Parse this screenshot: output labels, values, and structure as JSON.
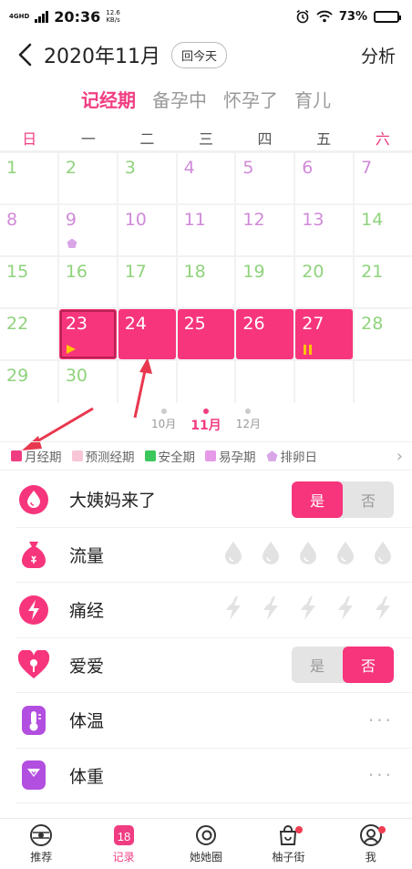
{
  "status_bar": {
    "network": "4GHD",
    "time": "20:36",
    "speed_value": "12.6",
    "speed_unit": "KB/s",
    "battery": "73%",
    "battery_level": 0.73
  },
  "header": {
    "title": "2020年11月",
    "today_button": "回今天",
    "analysis": "分析"
  },
  "mode_tabs": [
    {
      "label": "记经期",
      "active": true
    },
    {
      "label": "备孕中",
      "active": false
    },
    {
      "label": "怀孕了",
      "active": false
    },
    {
      "label": "育儿",
      "active": false
    }
  ],
  "weekdays": [
    "日",
    "一",
    "二",
    "三",
    "四",
    "五",
    "六"
  ],
  "days": [
    {
      "n": "1",
      "type": "green"
    },
    {
      "n": "2",
      "type": "green"
    },
    {
      "n": "3",
      "type": "green"
    },
    {
      "n": "4",
      "type": "purple"
    },
    {
      "n": "5",
      "type": "purple"
    },
    {
      "n": "6",
      "type": "purple"
    },
    {
      "n": "7",
      "type": "purple"
    },
    {
      "n": "8",
      "type": "purple"
    },
    {
      "n": "9",
      "type": "purple",
      "mark": "ovulation"
    },
    {
      "n": "10",
      "type": "purple"
    },
    {
      "n": "11",
      "type": "purple"
    },
    {
      "n": "12",
      "type": "purple"
    },
    {
      "n": "13",
      "type": "purple"
    },
    {
      "n": "14",
      "type": "green"
    },
    {
      "n": "15",
      "type": "green"
    },
    {
      "n": "16",
      "type": "green"
    },
    {
      "n": "17",
      "type": "green"
    },
    {
      "n": "18",
      "type": "green"
    },
    {
      "n": "19",
      "type": "green"
    },
    {
      "n": "20",
      "type": "green"
    },
    {
      "n": "21",
      "type": "green"
    },
    {
      "n": "22",
      "type": "green"
    },
    {
      "n": "23",
      "type": "period",
      "selected": true,
      "mark": "start"
    },
    {
      "n": "24",
      "type": "period"
    },
    {
      "n": "25",
      "type": "period"
    },
    {
      "n": "26",
      "type": "period"
    },
    {
      "n": "27",
      "type": "period",
      "mark": "end"
    },
    {
      "n": "28",
      "type": "green"
    },
    {
      "n": "29",
      "type": "green"
    },
    {
      "n": "30",
      "type": "green"
    },
    {
      "n": "",
      "type": "empty"
    },
    {
      "n": "",
      "type": "empty"
    },
    {
      "n": "",
      "type": "empty"
    },
    {
      "n": "",
      "type": "empty"
    },
    {
      "n": "",
      "type": "empty"
    }
  ],
  "months": [
    {
      "label": "10月",
      "active": false
    },
    {
      "label": "11月",
      "active": true
    },
    {
      "label": "12月",
      "active": false
    }
  ],
  "legend": [
    {
      "label": "月经期",
      "color": "#f03d82",
      "shape": "square"
    },
    {
      "label": "预测经期",
      "color": "#f8c6d6",
      "shape": "square"
    },
    {
      "label": "安全期",
      "color": "#3cc75a",
      "shape": "square"
    },
    {
      "label": "易孕期",
      "color": "#e59ae8",
      "shape": "square"
    },
    {
      "label": "排卵日",
      "color": "#d9a6e8",
      "shape": "pentagon"
    }
  ],
  "records": {
    "period_started": {
      "label": "大姨妈来了",
      "yes": "是",
      "no": "否",
      "value": "yes"
    },
    "flow": {
      "label": "流量",
      "levels": 5
    },
    "cramps": {
      "label": "痛经",
      "levels": 5
    },
    "love": {
      "label": "爱爱",
      "yes": "是",
      "no": "否",
      "value": "no"
    },
    "temperature": {
      "label": "体温",
      "more": "···"
    },
    "weight": {
      "label": "体重",
      "more": "···"
    }
  },
  "bottom_nav": [
    {
      "label": "推荐",
      "icon": "compass-icon",
      "active": false
    },
    {
      "label": "记录",
      "icon": "calendar-icon",
      "date": "18",
      "active": true
    },
    {
      "label": "她她圈",
      "icon": "community-icon",
      "active": false
    },
    {
      "label": "柚子街",
      "icon": "shop-bag-icon",
      "active": false,
      "badge": true
    },
    {
      "label": "我",
      "icon": "profile-icon",
      "active": false,
      "badge": true
    }
  ]
}
